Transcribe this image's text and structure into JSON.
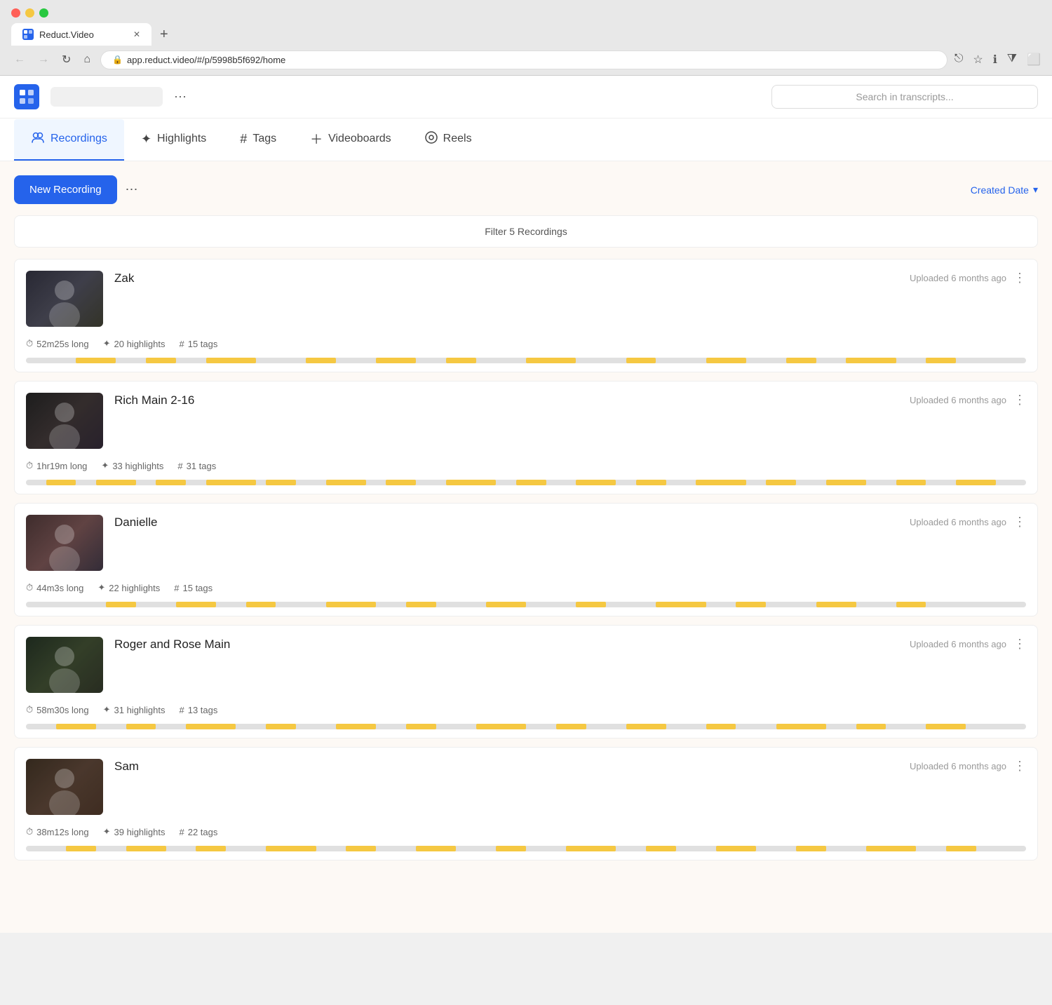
{
  "browser": {
    "url": "app.reduct.video/#/p/5998b5f692/home",
    "tab_title": "Reduct.Video",
    "tab_favicon": "R"
  },
  "header": {
    "logo_text": "R",
    "workspace_placeholder": "",
    "search_placeholder": "Search in transcripts...",
    "more_label": "⋯"
  },
  "nav": {
    "tabs": [
      {
        "id": "recordings",
        "icon": "👥",
        "label": "Recordings",
        "active": true
      },
      {
        "id": "highlights",
        "icon": "✦",
        "label": "Highlights",
        "active": false
      },
      {
        "id": "tags",
        "icon": "#",
        "label": "Tags",
        "active": false
      },
      {
        "id": "videoboards",
        "icon": "+",
        "label": "Videoboards",
        "active": false
      },
      {
        "id": "reels",
        "icon": "⚙",
        "label": "Reels",
        "active": false
      }
    ]
  },
  "toolbar": {
    "new_recording_label": "New Recording",
    "sort_label": "Created Date",
    "more_icon": "⋯"
  },
  "filter_bar": {
    "label": "Filter 5 Recordings"
  },
  "recordings": [
    {
      "id": "zak",
      "title": "Zak",
      "uploaded": "Uploaded 6 months ago",
      "duration": "52m25s long",
      "highlights": "20 highlights",
      "tags": "15 tags",
      "thumb_class": "thumb-zak",
      "timeline_segments": [
        {
          "left": "5%",
          "width": "4%"
        },
        {
          "left": "12%",
          "width": "3%"
        },
        {
          "left": "18%",
          "width": "5%"
        },
        {
          "left": "28%",
          "width": "3%"
        },
        {
          "left": "35%",
          "width": "4%"
        },
        {
          "left": "42%",
          "width": "3%"
        },
        {
          "left": "50%",
          "width": "5%"
        },
        {
          "left": "60%",
          "width": "3%"
        },
        {
          "left": "68%",
          "width": "4%"
        },
        {
          "left": "76%",
          "width": "3%"
        },
        {
          "left": "82%",
          "width": "5%"
        },
        {
          "left": "90%",
          "width": "3%"
        }
      ]
    },
    {
      "id": "rich",
      "title": "Rich Main 2-16",
      "uploaded": "Uploaded 6 months ago",
      "duration": "1hr19m long",
      "highlights": "33 highlights",
      "tags": "31 tags",
      "thumb_class": "thumb-rich",
      "timeline_segments": [
        {
          "left": "2%",
          "width": "3%"
        },
        {
          "left": "7%",
          "width": "4%"
        },
        {
          "left": "13%",
          "width": "3%"
        },
        {
          "left": "18%",
          "width": "5%"
        },
        {
          "left": "24%",
          "width": "3%"
        },
        {
          "left": "30%",
          "width": "4%"
        },
        {
          "left": "36%",
          "width": "3%"
        },
        {
          "left": "42%",
          "width": "5%"
        },
        {
          "left": "49%",
          "width": "3%"
        },
        {
          "left": "55%",
          "width": "4%"
        },
        {
          "left": "61%",
          "width": "3%"
        },
        {
          "left": "67%",
          "width": "5%"
        },
        {
          "left": "74%",
          "width": "3%"
        },
        {
          "left": "80%",
          "width": "4%"
        },
        {
          "left": "87%",
          "width": "3%"
        },
        {
          "left": "93%",
          "width": "4%"
        }
      ]
    },
    {
      "id": "danielle",
      "title": "Danielle",
      "uploaded": "Uploaded 6 months ago",
      "duration": "44m3s long",
      "highlights": "22 highlights",
      "tags": "15 tags",
      "thumb_class": "thumb-danielle",
      "timeline_segments": [
        {
          "left": "8%",
          "width": "3%"
        },
        {
          "left": "15%",
          "width": "4%"
        },
        {
          "left": "22%",
          "width": "3%"
        },
        {
          "left": "30%",
          "width": "5%"
        },
        {
          "left": "38%",
          "width": "3%"
        },
        {
          "left": "46%",
          "width": "4%"
        },
        {
          "left": "55%",
          "width": "3%"
        },
        {
          "left": "63%",
          "width": "5%"
        },
        {
          "left": "71%",
          "width": "3%"
        },
        {
          "left": "79%",
          "width": "4%"
        },
        {
          "left": "87%",
          "width": "3%"
        }
      ]
    },
    {
      "id": "roger",
      "title": "Roger and Rose Main",
      "uploaded": "Uploaded 6 months ago",
      "duration": "58m30s long",
      "highlights": "31 highlights",
      "tags": "13 tags",
      "thumb_class": "thumb-roger",
      "timeline_segments": [
        {
          "left": "3%",
          "width": "4%"
        },
        {
          "left": "10%",
          "width": "3%"
        },
        {
          "left": "16%",
          "width": "5%"
        },
        {
          "left": "24%",
          "width": "3%"
        },
        {
          "left": "31%",
          "width": "4%"
        },
        {
          "left": "38%",
          "width": "3%"
        },
        {
          "left": "45%",
          "width": "5%"
        },
        {
          "left": "53%",
          "width": "3%"
        },
        {
          "left": "60%",
          "width": "4%"
        },
        {
          "left": "68%",
          "width": "3%"
        },
        {
          "left": "75%",
          "width": "5%"
        },
        {
          "left": "83%",
          "width": "3%"
        },
        {
          "left": "90%",
          "width": "4%"
        }
      ]
    },
    {
      "id": "sam",
      "title": "Sam",
      "uploaded": "Uploaded 6 months ago",
      "duration": "38m12s long",
      "highlights": "39 highlights",
      "tags": "22 tags",
      "thumb_class": "thumb-sam",
      "timeline_segments": [
        {
          "left": "4%",
          "width": "3%"
        },
        {
          "left": "10%",
          "width": "4%"
        },
        {
          "left": "17%",
          "width": "3%"
        },
        {
          "left": "24%",
          "width": "5%"
        },
        {
          "left": "32%",
          "width": "3%"
        },
        {
          "left": "39%",
          "width": "4%"
        },
        {
          "left": "47%",
          "width": "3%"
        },
        {
          "left": "54%",
          "width": "5%"
        },
        {
          "left": "62%",
          "width": "3%"
        },
        {
          "left": "69%",
          "width": "4%"
        },
        {
          "left": "77%",
          "width": "3%"
        },
        {
          "left": "84%",
          "width": "5%"
        },
        {
          "left": "92%",
          "width": "3%"
        }
      ]
    }
  ],
  "icons": {
    "clock": "🕐",
    "highlight": "✦",
    "hash": "#",
    "lock": "🔒",
    "back": "←",
    "forward": "→",
    "reload": "↻",
    "home": "⌂",
    "share": "⎋",
    "star": "☆",
    "extension": "⧩",
    "window": "⬜",
    "more_vert": "⋮",
    "sort_down": "▾"
  }
}
